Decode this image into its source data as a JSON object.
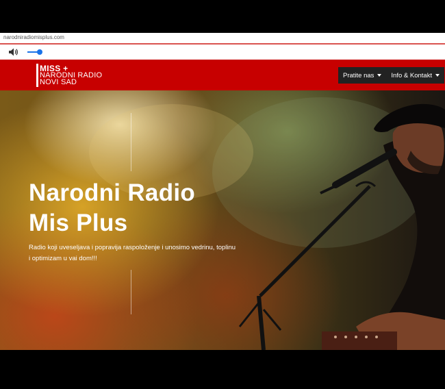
{
  "browser": {
    "url": "narodniradiomisplus.com"
  },
  "audio_player": {
    "volume_level": 0.8
  },
  "header": {
    "logo": {
      "line1": "MISS +",
      "line2": "NARODNI RADIO",
      "line3": "NOVI SAD"
    },
    "menu": [
      {
        "label": "Pratite nas"
      },
      {
        "label": "Info & Kontakt"
      }
    ],
    "colors": {
      "navbar": "#c70000",
      "menu_bg": "#222222"
    }
  },
  "hero": {
    "title_line1": "Narodni Radio",
    "title_line2": "Mis Plus",
    "subtitle": "Radio koji uveseljava i popravija raspoloženje i unosimo vedrinu, toplinu i optimizam u vai dom!!!"
  }
}
